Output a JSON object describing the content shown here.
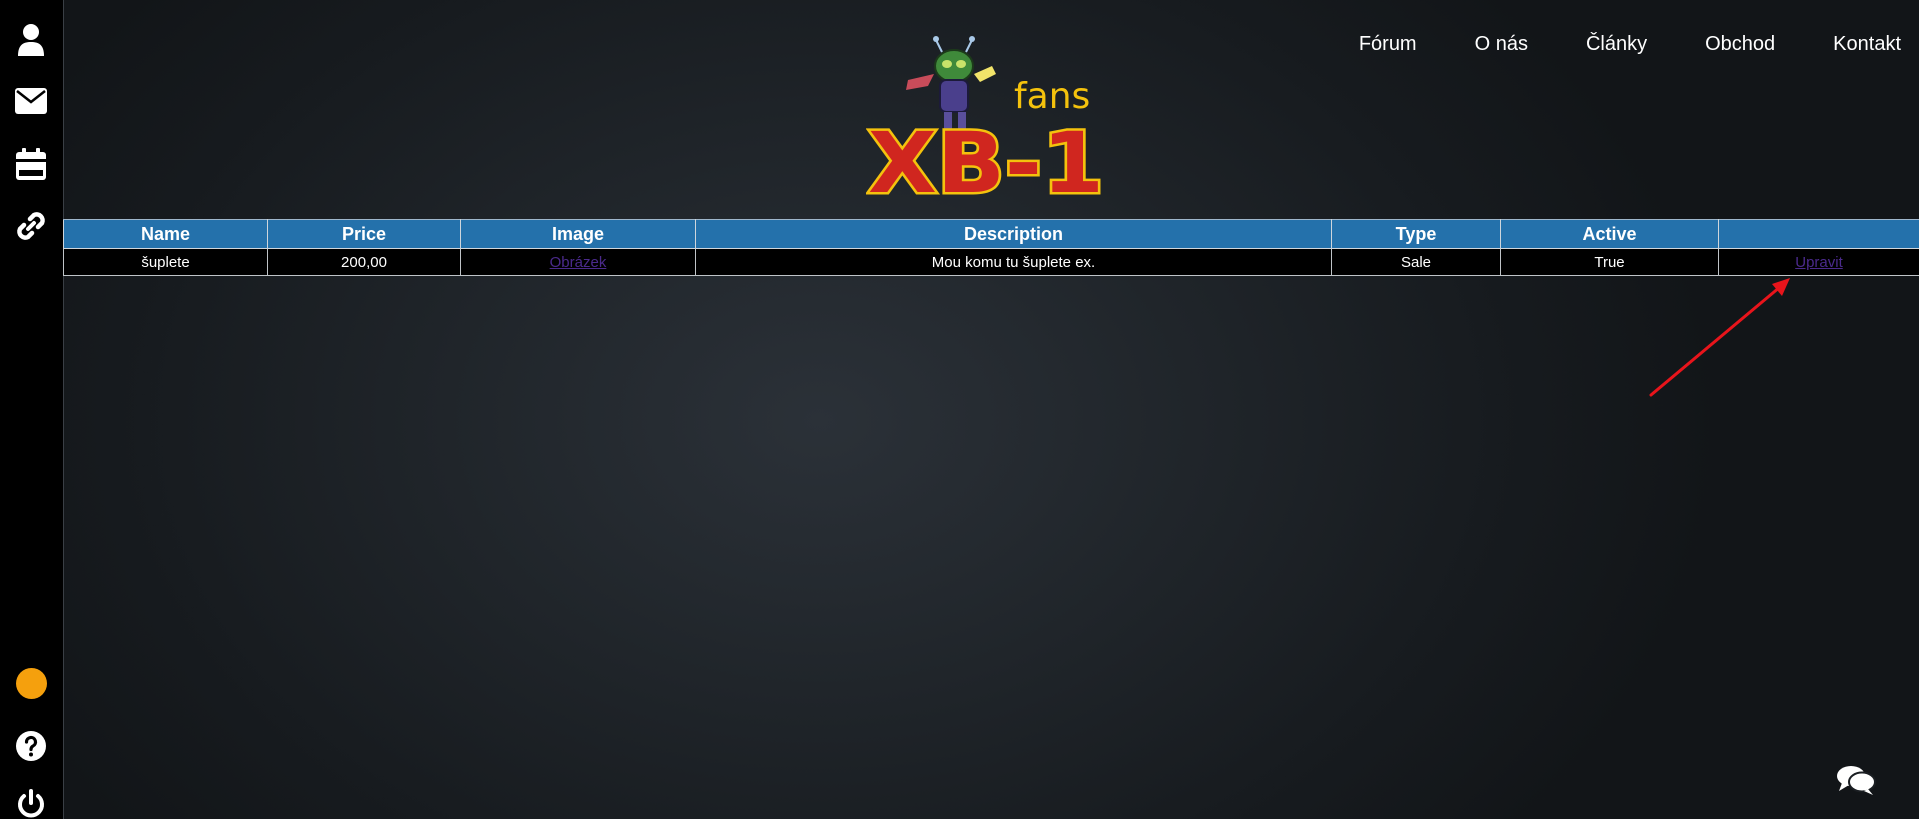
{
  "sidebar": {
    "icons": [
      "user-icon",
      "envelope-icon",
      "calendar-icon",
      "link-icon",
      "status-dot",
      "help-icon",
      "power-icon"
    ],
    "status_color": "#f5a00d"
  },
  "nav": {
    "items": [
      {
        "label": "Fórum"
      },
      {
        "label": "O nás"
      },
      {
        "label": "Články"
      },
      {
        "label": "Obchod"
      },
      {
        "label": "Kontakt"
      }
    ]
  },
  "logo": {
    "word_small": "fans",
    "word_big": "XB-1"
  },
  "table": {
    "headers": [
      "Name",
      "Price",
      "Image",
      "Description",
      "Type",
      "Active",
      ""
    ],
    "rows": [
      {
        "name": "šuplete",
        "price": "200,00",
        "image_link": "Obrázek",
        "description": "Mou komu tu šuplete ex.",
        "type": "Sale",
        "active": "True",
        "edit_link": "Upravit"
      }
    ]
  },
  "colors": {
    "header_bg": "#2471ab",
    "link": "#4b2a8c",
    "annotation": "#e8141b",
    "logo_yellow": "#f4c20d",
    "logo_red": "#d0261f"
  }
}
